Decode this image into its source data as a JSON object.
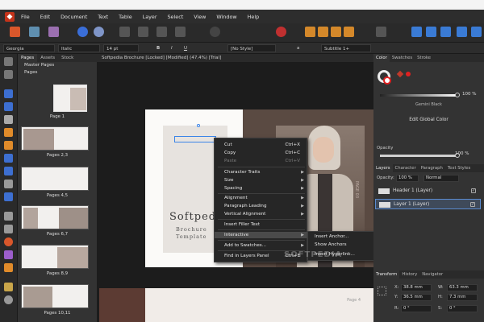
{
  "menubar": {
    "items": [
      "File",
      "Edit",
      "Document",
      "Text",
      "Table",
      "Layer",
      "Select",
      "View",
      "Window",
      "Help"
    ]
  },
  "context_toolbar": {
    "font": "Georgia",
    "style": "Italic",
    "size": "14 pt",
    "bold": "B",
    "italic": "I",
    "underline": "U",
    "char_style": "[No Style]",
    "para_style": "Subtitle 1+",
    "para_symbol": "a"
  },
  "pages_panel": {
    "tabs": [
      "Pages",
      "Assets",
      "Stock"
    ],
    "master_pages": "Master Pages",
    "pages": "Pages",
    "thumbs": [
      "Page 1",
      "Pages 2,3",
      "Pages 4,5",
      "Pages 6,7",
      "Pages 8,9",
      "Pages 10,11"
    ]
  },
  "document": {
    "tab_title": "Softpedia Brochure [Locked] [Modified] (47.4%) [Trial]",
    "title_text": "Softped",
    "subtitle_1": "Brochure",
    "subtitle_2": "Template",
    "side_label": "PAGE 03",
    "bottom_label": "Page 4"
  },
  "context_menu": {
    "items": [
      {
        "label": "Cut",
        "shortcut": "Ctrl+X"
      },
      {
        "label": "Copy",
        "shortcut": "Ctrl+C"
      },
      {
        "label": "Paste",
        "shortcut": "Ctrl+V"
      },
      {
        "label": "Character Traits",
        "shortcut": ""
      },
      {
        "label": "Size",
        "shortcut": ""
      },
      {
        "label": "Spacing",
        "shortcut": ""
      },
      {
        "label": "Alignment",
        "shortcut": ""
      },
      {
        "label": "Paragraph Leading",
        "shortcut": ""
      },
      {
        "label": "Vertical Alignment",
        "shortcut": ""
      },
      {
        "label": "Insert Filler Text",
        "shortcut": ""
      },
      {
        "label": "Interactive",
        "shortcut": ""
      },
      {
        "label": "Add to Swatches...",
        "shortcut": ""
      },
      {
        "label": "Find in Layers Panel",
        "shortcut": "Ctrl+E"
      }
    ],
    "submenu": [
      "Insert Anchor...",
      "Show Anchors",
      "Insert Hyperlink..."
    ]
  },
  "watermark": "SOFTPEDIA",
  "color_panel": {
    "tabs": [
      "Color",
      "Swatches",
      "Stroke"
    ],
    "tint_value": "100 %",
    "color_name": "Gemini Black",
    "edit_label": "Edit Global Color",
    "opacity_label": "Opacity",
    "opacity_value": "100 %"
  },
  "layers_panel": {
    "tabs": [
      "Layers",
      "Character",
      "Paragraph",
      "Text Styles"
    ],
    "opacity_label": "Opacity:",
    "opacity_value": "100 %",
    "blend_mode": "Normal",
    "layers": [
      "Header 1 (Layer)",
      "Layer 1 (Layer)"
    ]
  },
  "transform_panel": {
    "tabs": [
      "Transform",
      "History",
      "Navigator"
    ],
    "x_label": "X:",
    "x_value": "38.8 mm",
    "y_label": "Y:",
    "y_value": "36.5 mm",
    "w_label": "W:",
    "w_value": "63.3 mm",
    "h_label": "H:",
    "h_value": "7.3 mm",
    "r_label": "R:",
    "r_value": "0 °",
    "s_label": "S:",
    "s_value": "0 °"
  },
  "colors": {
    "accent_red": "#e02020",
    "photo_bg": "#5a4a42",
    "page_bg": "#fbfaf8"
  }
}
